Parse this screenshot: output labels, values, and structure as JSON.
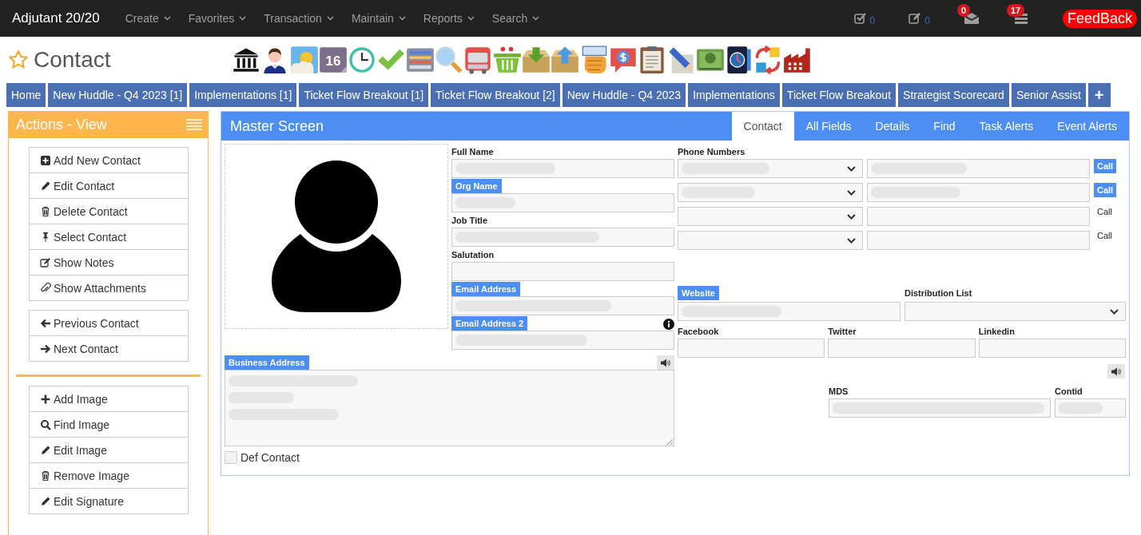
{
  "navbar": {
    "brand": "Adjutant 20/20",
    "menus": [
      "Create",
      "Favorites",
      "Transaction",
      "Maintain",
      "Reports",
      "Search"
    ],
    "indicators": [
      {
        "kind": "tasks",
        "count": "0"
      },
      {
        "kind": "notes",
        "count": "0"
      },
      {
        "kind": "mail",
        "badge": "0"
      },
      {
        "kind": "list",
        "badge": "17"
      }
    ],
    "feedback": "FeedBack"
  },
  "page": {
    "title": "Contact",
    "favorite": false,
    "calendar_label": "16"
  },
  "open_tabs": [
    "Home",
    "New Huddle - Q4 2023 [1]",
    "Implementations [1]",
    "Ticket Flow Breakout [1]",
    "Ticket Flow Breakout [2]",
    "New Huddle - Q4 2023",
    "Implementations",
    "Ticket Flow Breakout",
    "Strategist Scorecard",
    "Senior Assist"
  ],
  "add_tab": "+",
  "actions": {
    "title": "Actions - View",
    "groups": [
      [
        {
          "kind": "add",
          "label": "Add New Contact"
        },
        {
          "kind": "edit",
          "label": "Edit Contact"
        },
        {
          "kind": "delete",
          "label": "Delete Contact"
        },
        {
          "kind": "select",
          "label": "Select Contact"
        },
        {
          "kind": "notes",
          "label": "Show Notes"
        },
        {
          "kind": "attach",
          "label": "Show Attachments"
        }
      ],
      [
        {
          "kind": "previous",
          "label": "Previous Contact"
        },
        {
          "kind": "next",
          "label": "Next Contact"
        }
      ],
      [
        {
          "kind": "plus",
          "label": "Add Image"
        },
        {
          "kind": "find",
          "label": "Find Image"
        },
        {
          "kind": "edit",
          "label": "Edit Image"
        },
        {
          "kind": "delete",
          "label": "Remove Image"
        },
        {
          "kind": "edit",
          "label": "Edit Signature"
        }
      ]
    ]
  },
  "master": {
    "title": "Master Screen",
    "tabs": [
      {
        "label": "Contact",
        "selected": true
      },
      {
        "label": "All Fields",
        "selected": false
      },
      {
        "label": "Details",
        "selected": false
      },
      {
        "label": "Find",
        "selected": false
      },
      {
        "label": "Task Alerts",
        "selected": false
      },
      {
        "label": "Event Alerts",
        "selected": false
      }
    ],
    "fields": [
      {
        "label": "Full Name",
        "kind": "plain",
        "redacted": true,
        "info": false
      },
      {
        "label": "Org Name",
        "kind": "badge",
        "redacted": true,
        "info": false
      },
      {
        "label": "Job Title",
        "kind": "plain",
        "redacted": true,
        "info": false
      },
      {
        "label": "Salutation",
        "kind": "plain",
        "redacted": false,
        "info": false
      },
      {
        "label": "Email Address",
        "kind": "badge",
        "redacted": true,
        "info": false
      },
      {
        "label": "Email Address 2",
        "kind": "badge",
        "redacted": true,
        "info": true
      }
    ],
    "business_address": {
      "label": "Business Address",
      "redacted": true
    },
    "def_contact": {
      "label": "Def Contact",
      "checked": false
    },
    "phone_label": "Phone Numbers",
    "phones": [
      {
        "redacted": true,
        "call": "Call",
        "call_enabled": true
      },
      {
        "redacted": true,
        "call": "Call",
        "call_enabled": true
      },
      {
        "redacted": false,
        "call": "Call",
        "call_enabled": false
      },
      {
        "redacted": false,
        "call": "Call",
        "call_enabled": false
      }
    ],
    "website": {
      "label": "Website",
      "redacted": true
    },
    "distribution_list": {
      "label": "Distribution List"
    },
    "social": [
      "Facebook",
      "Twitter",
      "Linkedin"
    ],
    "mds": {
      "label": "MDS",
      "redacted": true
    },
    "contid": {
      "label": "Contid",
      "redacted": true
    }
  }
}
